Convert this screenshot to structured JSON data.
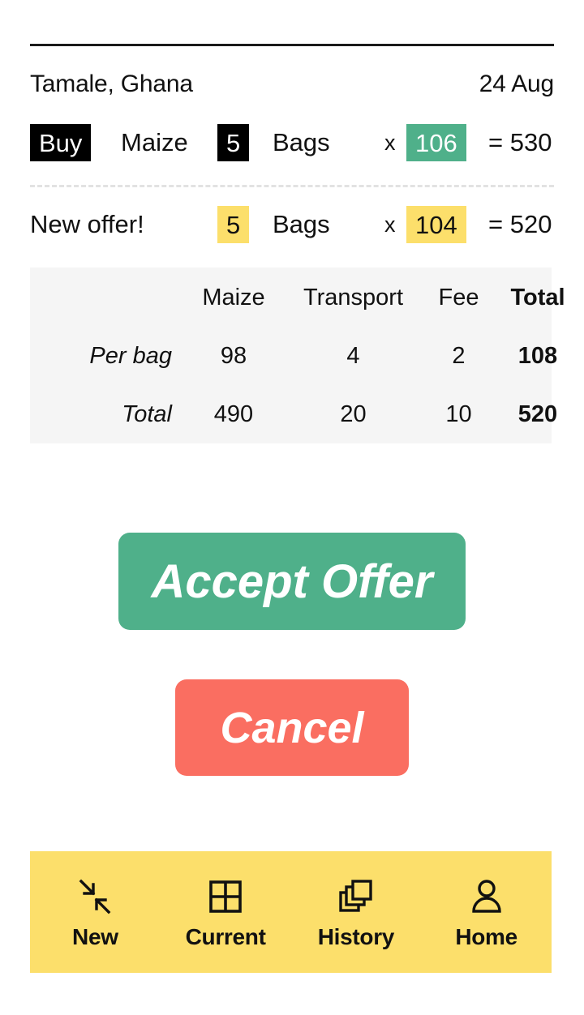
{
  "header": {
    "location": "Tamale, Ghana",
    "date": "24 Aug"
  },
  "order": {
    "action_label": "Buy",
    "commodity": "Maize",
    "quantity": "5",
    "unit": "Bags",
    "multiply_symbol": "x",
    "unit_price": "106",
    "equals_symbol": "=",
    "total": "530"
  },
  "offer": {
    "label": "New offer!",
    "quantity": "5",
    "unit": "Bags",
    "multiply_symbol": "x",
    "unit_price": "104",
    "equals_symbol": "=",
    "total": "520"
  },
  "breakdown": {
    "columns": [
      "",
      "Maize",
      "Transport",
      "Fee",
      "Total"
    ],
    "rows": [
      {
        "label": "Per bag",
        "maize": "98",
        "transport": "4",
        "fee": "2",
        "total": "108"
      },
      {
        "label": "Total",
        "maize": "490",
        "transport": "20",
        "fee": "10",
        "total": "520"
      }
    ]
  },
  "actions": {
    "accept_label": "Accept Offer",
    "cancel_label": "Cancel"
  },
  "bottom_nav": {
    "items": [
      {
        "label": "New",
        "icon": "converge-arrows-icon"
      },
      {
        "label": "Current",
        "icon": "grid-2x2-icon"
      },
      {
        "label": "History",
        "icon": "stacked-squares-icon"
      },
      {
        "label": "Home",
        "icon": "person-icon"
      }
    ]
  },
  "colors": {
    "accent_green": "#4FB08A",
    "accent_yellow": "#FCDF6B",
    "accent_red": "#FA6E61",
    "chip_dark": "#000000",
    "panel_gray": "#F5F5F5"
  }
}
